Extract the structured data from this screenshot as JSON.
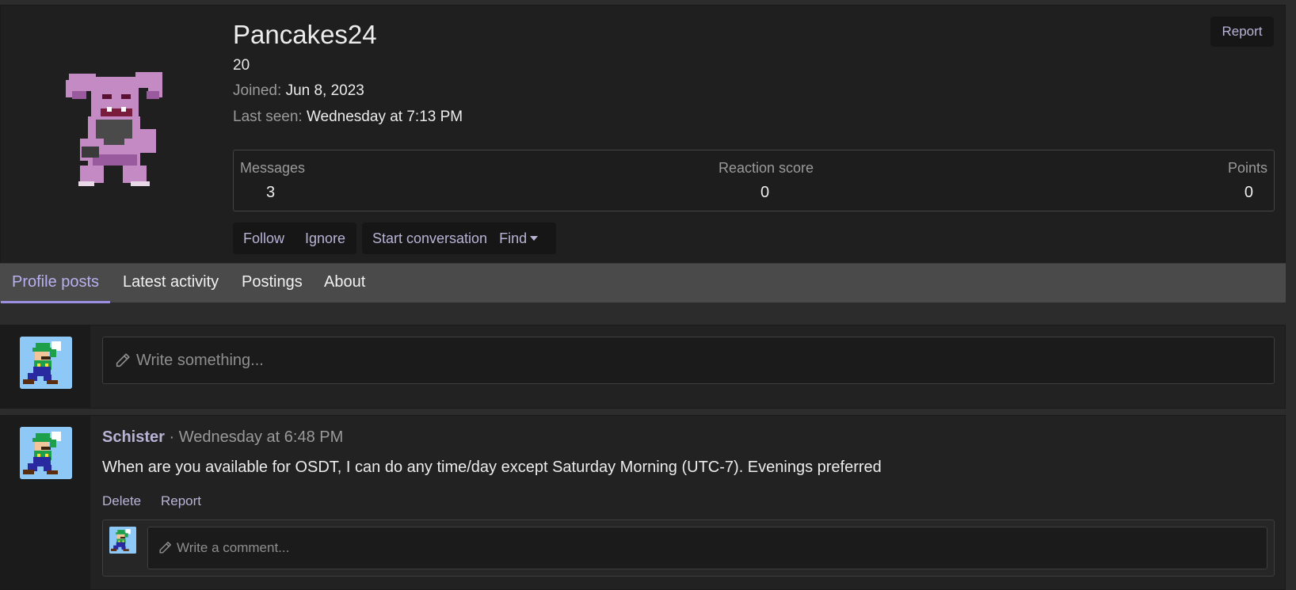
{
  "profile": {
    "username": "Pancakes24",
    "user_title": "20",
    "joined_label": "Joined:",
    "joined_value": "Jun 8, 2023",
    "last_seen_label": "Last seen:",
    "last_seen_value": "Wednesday at 7:13 PM",
    "report_label": "Report",
    "avatar_icon": "pokemon-granbull-sprite"
  },
  "stats": {
    "messages_label": "Messages",
    "messages_value": "3",
    "reaction_label": "Reaction score",
    "reaction_value": "0",
    "points_label": "Points",
    "points_value": "0"
  },
  "actions": {
    "follow": "Follow",
    "ignore": "Ignore",
    "start_conversation": "Start conversation",
    "find": "Find"
  },
  "tabs": [
    {
      "label": "Profile posts",
      "active": true
    },
    {
      "label": "Latest activity",
      "active": false
    },
    {
      "label": "Postings",
      "active": false
    },
    {
      "label": "About",
      "active": false
    }
  ],
  "composer": {
    "placeholder": "Write something...",
    "avatar_icon": "luigi-sprite"
  },
  "post": {
    "author": "Schister",
    "separator": " · ",
    "time": "Wednesday at 6:48 PM",
    "body": "When are you available for OSDT, I can do any time/day except Saturday Morning (UTC-7). Evenings preferred",
    "delete_label": "Delete",
    "report_label": "Report",
    "comment_placeholder": "Write a comment..."
  },
  "colors": {
    "accent": "#b9b3d6",
    "active_tab": "#9a8fe0",
    "background": "#2c2c2c",
    "panel": "#1f1f1f"
  }
}
